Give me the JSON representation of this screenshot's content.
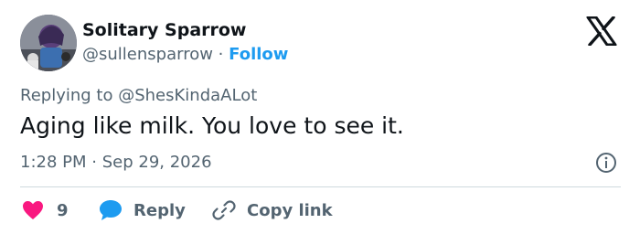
{
  "user": {
    "display_name": "Solitary Sparrow",
    "handle": "@sullensparrow",
    "separator": "·",
    "follow_label": "Follow"
  },
  "tweet": {
    "replying_to_prefix": "Replying to",
    "replying_to_handle": "@ShesKindaALot",
    "text": "Aging like milk. You love to see it.",
    "time": "1:28 PM",
    "date": "Sep 29, 2026"
  },
  "actions": {
    "like_count": "9",
    "reply_label": "Reply",
    "copy_link_label": "Copy link"
  },
  "icons": {
    "brand": "x-logo-icon",
    "like": "heart-icon",
    "reply": "speech-bubble-icon",
    "copy": "link-icon",
    "info": "info-icon"
  },
  "colors": {
    "link_blue": "#1d9bf0",
    "like_pink": "#f91880",
    "secondary_text": "#536471",
    "primary_text": "#0f1419",
    "divider": "#cfd9de"
  }
}
